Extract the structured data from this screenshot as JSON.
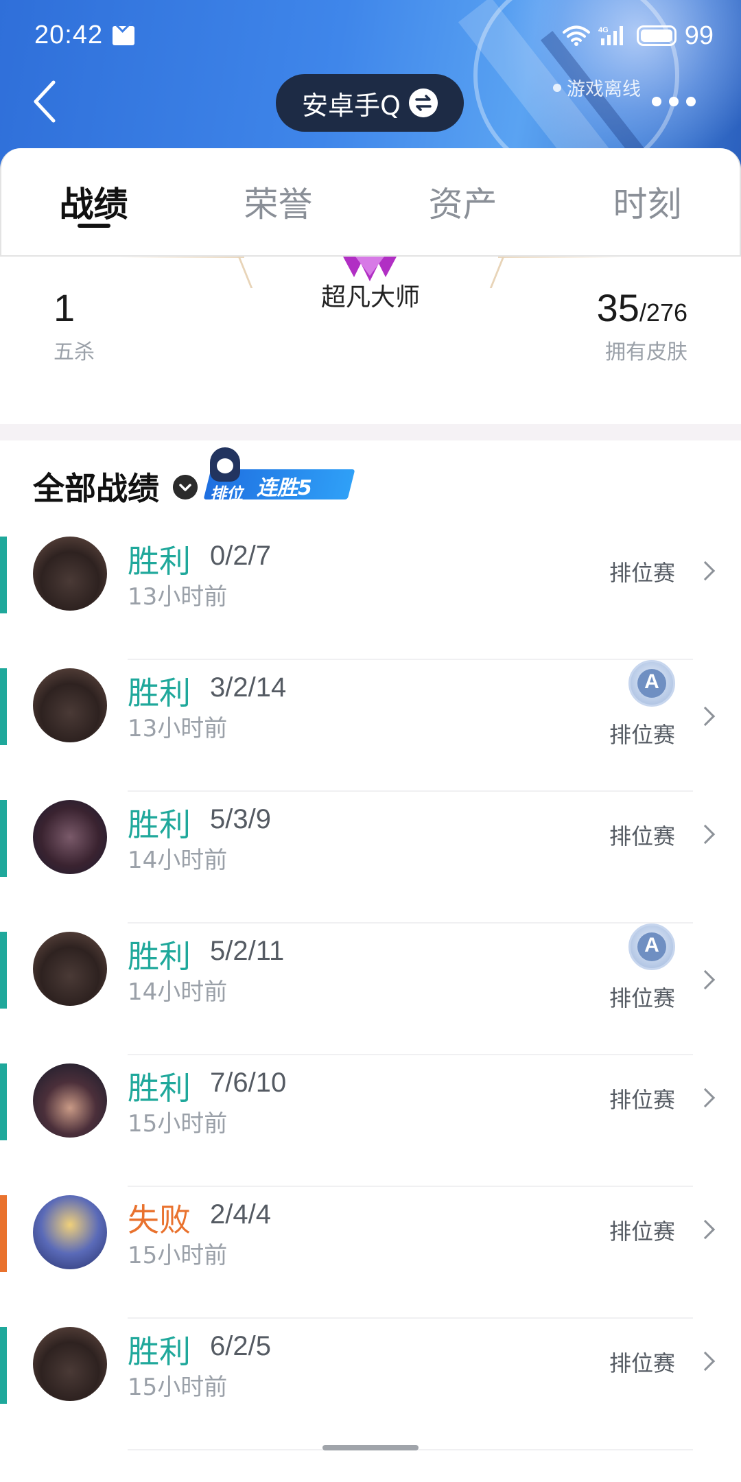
{
  "status_bar": {
    "time": "20:42",
    "battery": "99"
  },
  "header": {
    "account_name": "安卓手Q",
    "game_status": "游戏离线"
  },
  "tabs": [
    {
      "label": "战绩",
      "active": true
    },
    {
      "label": "荣誉",
      "active": false
    },
    {
      "label": "资产",
      "active": false
    },
    {
      "label": "时刻",
      "active": false
    }
  ],
  "stats": {
    "rank_name": "超凡大师",
    "penta_kills": "1",
    "penta_kills_label": "五杀",
    "skins_owned": "35",
    "skins_total": "/276",
    "skins_label": "拥有皮肤"
  },
  "section": {
    "title": "全部战绩",
    "streak_mode": "排位",
    "streak_label": "连胜5"
  },
  "matches": [
    {
      "result": "胜利",
      "kda": "0/2/7",
      "time": "13小时前",
      "mode": "排位赛",
      "mvp": false,
      "win": true
    },
    {
      "result": "胜利",
      "kda": "3/2/14",
      "time": "13小时前",
      "mode": "排位赛",
      "mvp": true,
      "win": true
    },
    {
      "result": "胜利",
      "kda": "5/3/9",
      "time": "14小时前",
      "mode": "排位赛",
      "mvp": false,
      "win": true
    },
    {
      "result": "胜利",
      "kda": "5/2/11",
      "time": "14小时前",
      "mode": "排位赛",
      "mvp": true,
      "win": true
    },
    {
      "result": "胜利",
      "kda": "7/6/10",
      "time": "15小时前",
      "mode": "排位赛",
      "mvp": false,
      "win": true
    },
    {
      "result": "失败",
      "kda": "2/4/4",
      "time": "15小时前",
      "mode": "排位赛",
      "mvp": false,
      "win": false
    },
    {
      "result": "胜利",
      "kda": "6/2/5",
      "time": "15小时前",
      "mode": "排位赛",
      "mvp": false,
      "win": true
    }
  ],
  "mvp_letter": "A",
  "colors": {
    "win": "#1fa89b",
    "loss": "#e9722e",
    "header": "#3b7de4"
  }
}
